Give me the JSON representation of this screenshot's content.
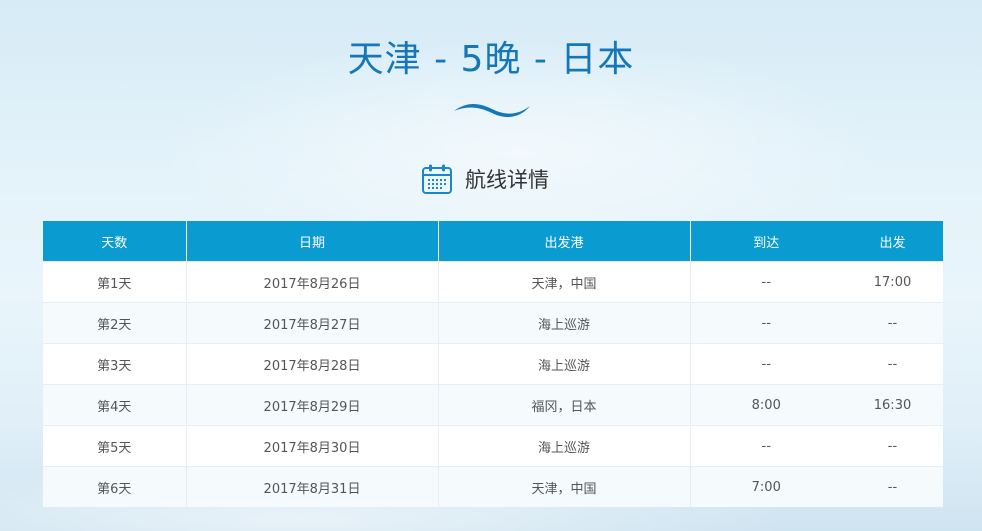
{
  "page": {
    "title": "天津 - 5晚 - 日本",
    "section_title": "航线详情"
  },
  "colors": {
    "title": "#1577b8",
    "header_bg": "#0a9bd1",
    "wave": "#1577b8"
  },
  "icons": {
    "wave": "wave-decoration-icon",
    "section": "calendar-icon"
  },
  "table": {
    "headers": {
      "day": "天数",
      "date": "日期",
      "port": "出发港",
      "arrive": "到达",
      "depart": "出发"
    },
    "rows": [
      {
        "day": "第1天",
        "date": "2017年8月26日",
        "port": "天津，中国",
        "arrive": "--",
        "depart": "17:00"
      },
      {
        "day": "第2天",
        "date": "2017年8月27日",
        "port": "海上巡游",
        "arrive": "--",
        "depart": "--"
      },
      {
        "day": "第3天",
        "date": "2017年8月28日",
        "port": "海上巡游",
        "arrive": "--",
        "depart": "--"
      },
      {
        "day": "第4天",
        "date": "2017年8月29日",
        "port": "福冈，日本",
        "arrive": "8:00",
        "depart": "16:30"
      },
      {
        "day": "第5天",
        "date": "2017年8月30日",
        "port": "海上巡游",
        "arrive": "--",
        "depart": "--"
      },
      {
        "day": "第6天",
        "date": "2017年8月31日",
        "port": "天津，中国",
        "arrive": "7:00",
        "depart": "--"
      }
    ]
  }
}
